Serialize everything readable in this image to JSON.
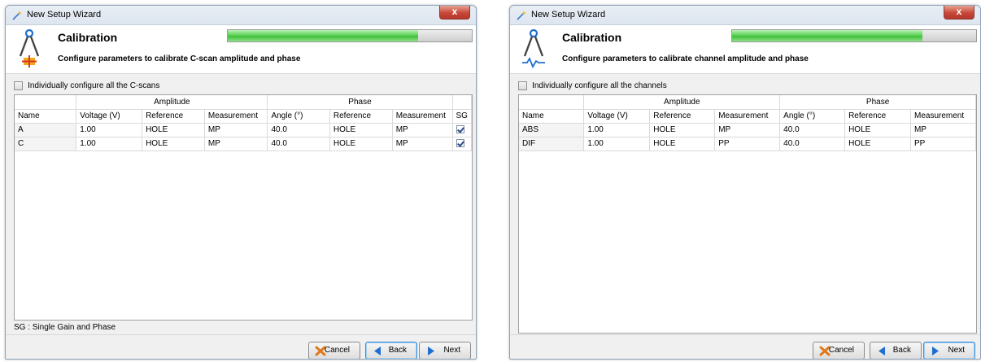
{
  "windows": [
    {
      "title": "New Setup Wizard",
      "close_label": "x",
      "header": {
        "title": "Calibration",
        "description": "Configure parameters to calibrate C-scan amplitude and phase",
        "progress": 0.78
      },
      "option_label": "Individually configure all the C-scans",
      "groups": {
        "amplitude": "Amplitude",
        "phase": "Phase"
      },
      "columns": [
        "Name",
        "Voltage (V)",
        "Reference",
        "Measurement",
        "Angle (°)",
        "Reference",
        "Measurement",
        "SG"
      ],
      "rows": [
        {
          "name": "A",
          "voltage": "1.00",
          "amp_ref": "HOLE",
          "amp_meas": "MP",
          "angle": "40.0",
          "ph_ref": "HOLE",
          "ph_meas": "MP",
          "sg": true
        },
        {
          "name": "C",
          "voltage": "1.00",
          "amp_ref": "HOLE",
          "amp_meas": "MP",
          "angle": "40.0",
          "ph_ref": "HOLE",
          "ph_meas": "MP",
          "sg": true
        }
      ],
      "footer_note": "SG : Single Gain and Phase",
      "buttons": {
        "cancel": "Cancel",
        "back": "Back",
        "next": "Next"
      }
    },
    {
      "title": "New Setup Wizard",
      "close_label": "x",
      "header": {
        "title": "Calibration",
        "description": "Configure parameters to calibrate channel amplitude and phase",
        "progress": 0.78
      },
      "option_label": "Individually configure all the channels",
      "groups": {
        "amplitude": "Amplitude",
        "phase": "Phase"
      },
      "columns": [
        "Name",
        "Voltage (V)",
        "Reference",
        "Measurement",
        "Angle (°)",
        "Reference",
        "Measurement"
      ],
      "rows": [
        {
          "name": "ABS",
          "voltage": "1.00",
          "amp_ref": "HOLE",
          "amp_meas": "MP",
          "angle": "40.0",
          "ph_ref": "HOLE",
          "ph_meas": "MP"
        },
        {
          "name": "DIF",
          "voltage": "1.00",
          "amp_ref": "HOLE",
          "amp_meas": "PP",
          "angle": "40.0",
          "ph_ref": "HOLE",
          "ph_meas": "PP"
        }
      ],
      "buttons": {
        "cancel": "Cancel",
        "back": "Back",
        "next": "Next"
      }
    }
  ],
  "colors": {
    "progress_fill": "#4fcc4a",
    "close_button": "#c7483a",
    "accent_blue": "#1e6fd0",
    "cancel_icon": "#e07a1a"
  },
  "icons": [
    "wand-icon",
    "compass-icon",
    "waveform-icon",
    "cancel-x-icon",
    "back-arrow-icon",
    "next-arrow-icon"
  ]
}
